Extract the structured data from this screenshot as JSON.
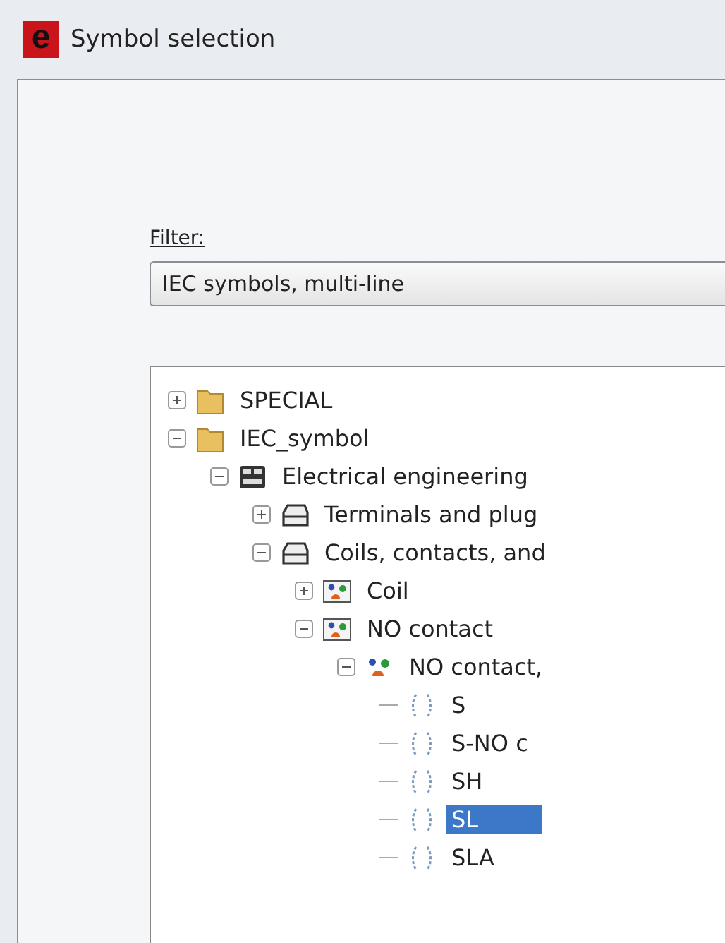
{
  "window": {
    "title": "Symbol selection",
    "logo_letter": "e"
  },
  "filter": {
    "label": "Filter:",
    "value": "IEC symbols, multi-line"
  },
  "tree": [
    {
      "label": "SPECIAL",
      "kind": "folder",
      "expanded": false,
      "selected": false
    },
    {
      "label": "IEC_symbol",
      "kind": "folder",
      "expanded": true,
      "selected": false,
      "children": [
        {
          "label": "Electrical engineering",
          "kind": "module",
          "expanded": true,
          "selected": false,
          "children": [
            {
              "label": "Terminals and plug",
              "kind": "group",
              "expanded": false,
              "selected": false
            },
            {
              "label": "Coils, contacts, and",
              "kind": "group",
              "expanded": true,
              "selected": false,
              "children": [
                {
                  "label": "Coil",
                  "kind": "category",
                  "expanded": false,
                  "selected": false
                },
                {
                  "label": "NO contact",
                  "kind": "category",
                  "expanded": true,
                  "selected": false,
                  "children": [
                    {
                      "label": "NO contact,",
                      "kind": "subcategory",
                      "expanded": true,
                      "selected": false,
                      "children": [
                        {
                          "label": "S",
                          "kind": "symbol",
                          "selected": false
                        },
                        {
                          "label": "S-NO c",
                          "kind": "symbol",
                          "selected": false
                        },
                        {
                          "label": "SH",
                          "kind": "symbol",
                          "selected": false
                        },
                        {
                          "label": "SL",
                          "kind": "symbol",
                          "selected": true
                        },
                        {
                          "label": "SLA",
                          "kind": "symbol",
                          "selected": false
                        }
                      ]
                    }
                  ]
                }
              ]
            }
          ]
        }
      ]
    }
  ]
}
